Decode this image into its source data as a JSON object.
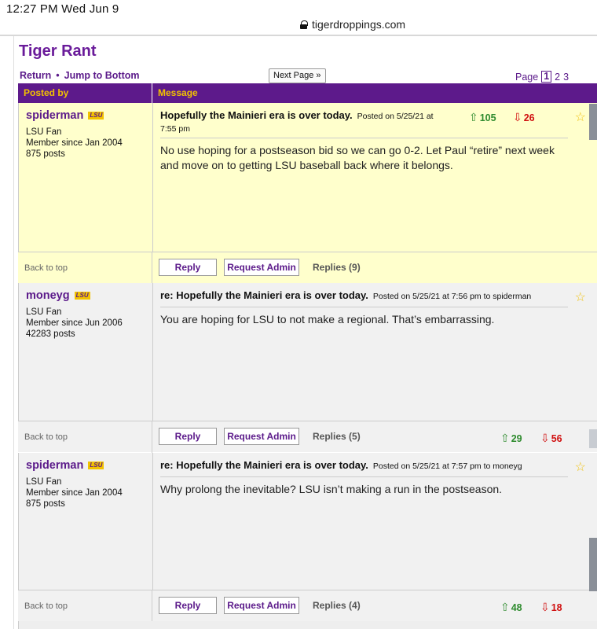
{
  "statusbar": {
    "time": "12:27 PM   Wed Jun 9",
    "url": "tigerdroppings.com"
  },
  "board": {
    "title": "Tiger Rant"
  },
  "nav": {
    "return_label": "Return",
    "jump_label": "Jump to Bottom",
    "next_page_label": "Next Page »"
  },
  "pager": {
    "label": "Page",
    "pages": [
      "1",
      "2",
      "3"
    ],
    "current": "1"
  },
  "table": {
    "col_posted_by": "Posted by",
    "col_message": "Message"
  },
  "posts": [
    {
      "author": "spiderman",
      "badge": "LSU",
      "team": "LSU Fan",
      "since": "Member since Jan 2004",
      "posts": "875 posts",
      "subject": "Hopefully the Mainieri era is over today.",
      "posted": "Posted on 5/25/21 at",
      "posted_line2": "7:55 pm",
      "body": "No use hoping for a postseason bid so we can go 0-2. Let Paul “retire” next week and move on to getting LSU baseball back where it belongs.",
      "up": "105",
      "down": "26",
      "back_to_top": "Back to top",
      "reply": "Reply",
      "request_admin": "Request Admin",
      "replies": "Replies (9)"
    },
    {
      "author": "moneyg",
      "badge": "LSU",
      "team": "LSU Fan",
      "since": "Member since Jun 2006",
      "posts": "42283 posts",
      "subject": "re: Hopefully the Mainieri era is over today.",
      "posted": "Posted on 5/25/21 at 7:56 pm to spiderman",
      "body": "You are hoping for LSU to not make a regional. That’s embarrassing.",
      "up": "29",
      "down": "56",
      "back_to_top": "Back to top",
      "reply": "Reply",
      "request_admin": "Request Admin",
      "replies": "Replies (5)"
    },
    {
      "author": "spiderman",
      "badge": "LSU",
      "team": "LSU Fan",
      "since": "Member since Jan 2004",
      "posts": "875 posts",
      "subject": "re: Hopefully the Mainieri era is over today.",
      "posted": "Posted on 5/25/21 at 7:57 pm to moneyg",
      "body": "Why prolong the inevitable? LSU isn’t making a run in the postseason.",
      "up": "48",
      "down": "18",
      "back_to_top": "Back to top",
      "reply": "Reply",
      "request_admin": "Request Admin",
      "replies": "Replies (4)"
    }
  ],
  "icons": {
    "upvote": "thumbs-up-arrow-icon",
    "downvote": "thumbs-down-arrow-icon",
    "favorite": "star-icon",
    "lock": "lock-icon"
  },
  "colors": {
    "purple": "#5d1a8b",
    "gold": "#f2c200",
    "op_bg": "#ffffcc",
    "reply_bg": "#f1f1f1",
    "up": "#2e8b2e",
    "down": "#d01010"
  }
}
